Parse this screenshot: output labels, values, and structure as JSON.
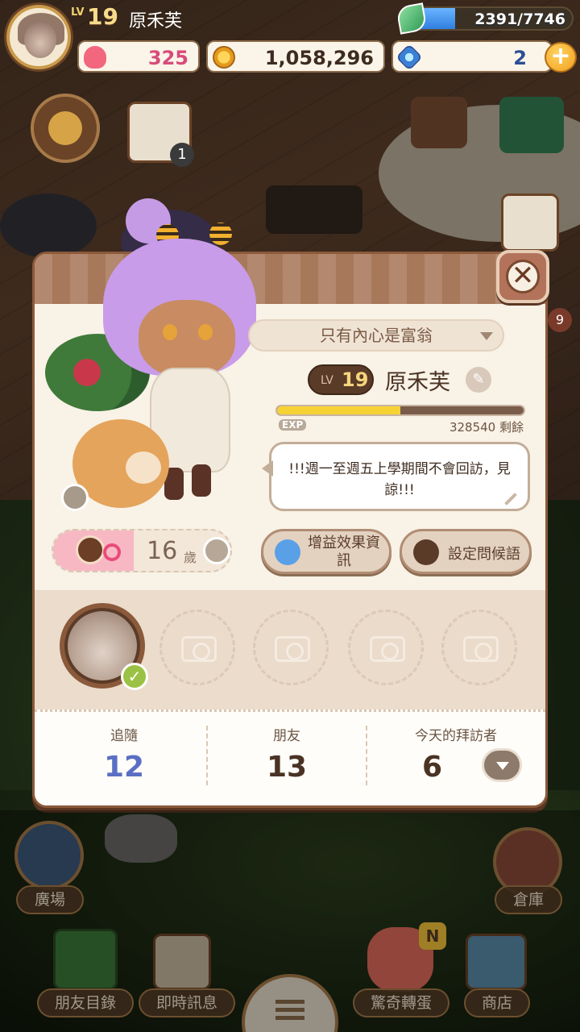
{
  "hud": {
    "level_prefix": "LV",
    "level": "19",
    "player_name": "原禾芙",
    "energy_text": "2391/7746",
    "energy_ratio": 0.309,
    "hearts": "325",
    "coins": "1,058,296",
    "gems": "2",
    "plus_label": "+"
  },
  "side_badges": {
    "calendar_count": "1",
    "right_badge": "9"
  },
  "profile": {
    "title_select": "只有內心是富翁",
    "level_prefix": "LV",
    "level": "19",
    "name": "原禾芙",
    "exp_label": "EXP",
    "exp_ratio": 0.5,
    "exp_remaining": "328540 剩餘",
    "greeting": "!!!週一至週五上學期間不會回訪，見諒!!!",
    "age": "16",
    "age_unit": "歲",
    "buff_button": "增益效果資訊",
    "greeting_button": "設定問候語",
    "close_label": "✕",
    "check_mark": "✓"
  },
  "stats": [
    {
      "label": "追隨",
      "value": "12",
      "color": "#5a6fc4"
    },
    {
      "label": "朋友",
      "value": "13",
      "color": "#4a3324"
    },
    {
      "label": "今天的拜訪者",
      "value": "6",
      "color": "#4a3324"
    }
  ],
  "bottom_nav": {
    "plaza": "廣場",
    "warehouse": "倉庫",
    "friends_list": "朋友目錄",
    "instant_message": "即時訊息",
    "surprise_gacha": "驚奇轉蛋",
    "shop": "商店",
    "gacha_badge": "N"
  },
  "colors": {
    "panel_bg": "#f7efe1",
    "panel_border": "#8b5a3b",
    "exp_fill": "#f7d234",
    "energy_fill": "#2f7fe0"
  }
}
